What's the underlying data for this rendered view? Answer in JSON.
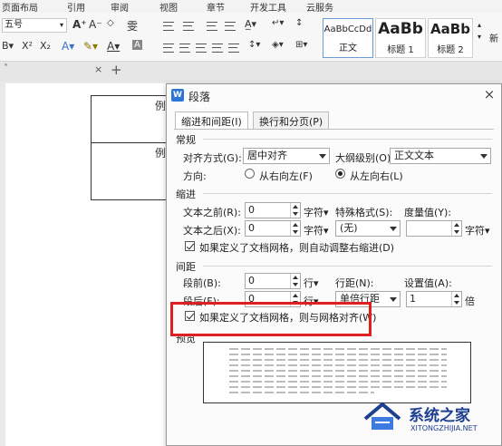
{
  "menu": [
    "页面布局",
    "引用",
    "审阅",
    "视图",
    "章节",
    "开发工具",
    "云服务"
  ],
  "ribbon": {
    "font_size": "五号",
    "styles": [
      {
        "preview": "AaBbCcDd",
        "name": "正文"
      },
      {
        "preview": "AaBb",
        "name": "标题 1"
      },
      {
        "preview": "AaBb",
        "name": "标题 2"
      },
      {
        "preview": "",
        "name": "新"
      }
    ]
  },
  "tabstrip": {
    "add": "+"
  },
  "document": {
    "cell1": "例",
    "cell2": "例"
  },
  "dialog": {
    "title": "段落",
    "app_icon": "W",
    "close": "×",
    "tabs": [
      "缩进和间距(I)",
      "换行和分页(P)"
    ],
    "general": {
      "header": "常规",
      "align_label": "对齐方式(G):",
      "align_value": "居中对齐",
      "outline_label": "大纲级别(O):",
      "outline_value": "正文文本",
      "direction_label": "方向:",
      "rtl": "从右向左(F)",
      "ltr": "从左向右(L)"
    },
    "indent": {
      "header": "缩进",
      "before_label": "文本之前(R):",
      "before_value": "0",
      "after_label": "文本之后(X):",
      "after_value": "0",
      "unit": "字符▾",
      "special_label": "特殊格式(S):",
      "special_value": "(无)",
      "measure_label": "度量值(Y):",
      "measure_value": "",
      "measure_unit": "字符▾",
      "grid_check": "如果定义了文档网格，则自动调整右缩进(D)"
    },
    "spacing": {
      "header": "间距",
      "before_label": "段前(B):",
      "before_value": "0",
      "after_label": "段后(F):",
      "after_value": "0",
      "unit": "行▾",
      "line_label": "行距(N):",
      "line_value": "单倍行距",
      "set_label": "设置值(A):",
      "set_value": "1",
      "set_unit": "倍",
      "grid_check": "如果定义了文档网格，则与网格对齐(W)"
    },
    "preview_header": "预览"
  },
  "watermark": {
    "name": "系统之家",
    "url": "XITONGZHIJIA.NET"
  },
  "colors": {
    "highlight": "#e02020",
    "app_icon": "#2b74d8",
    "watermark": "#1e3f8f"
  }
}
